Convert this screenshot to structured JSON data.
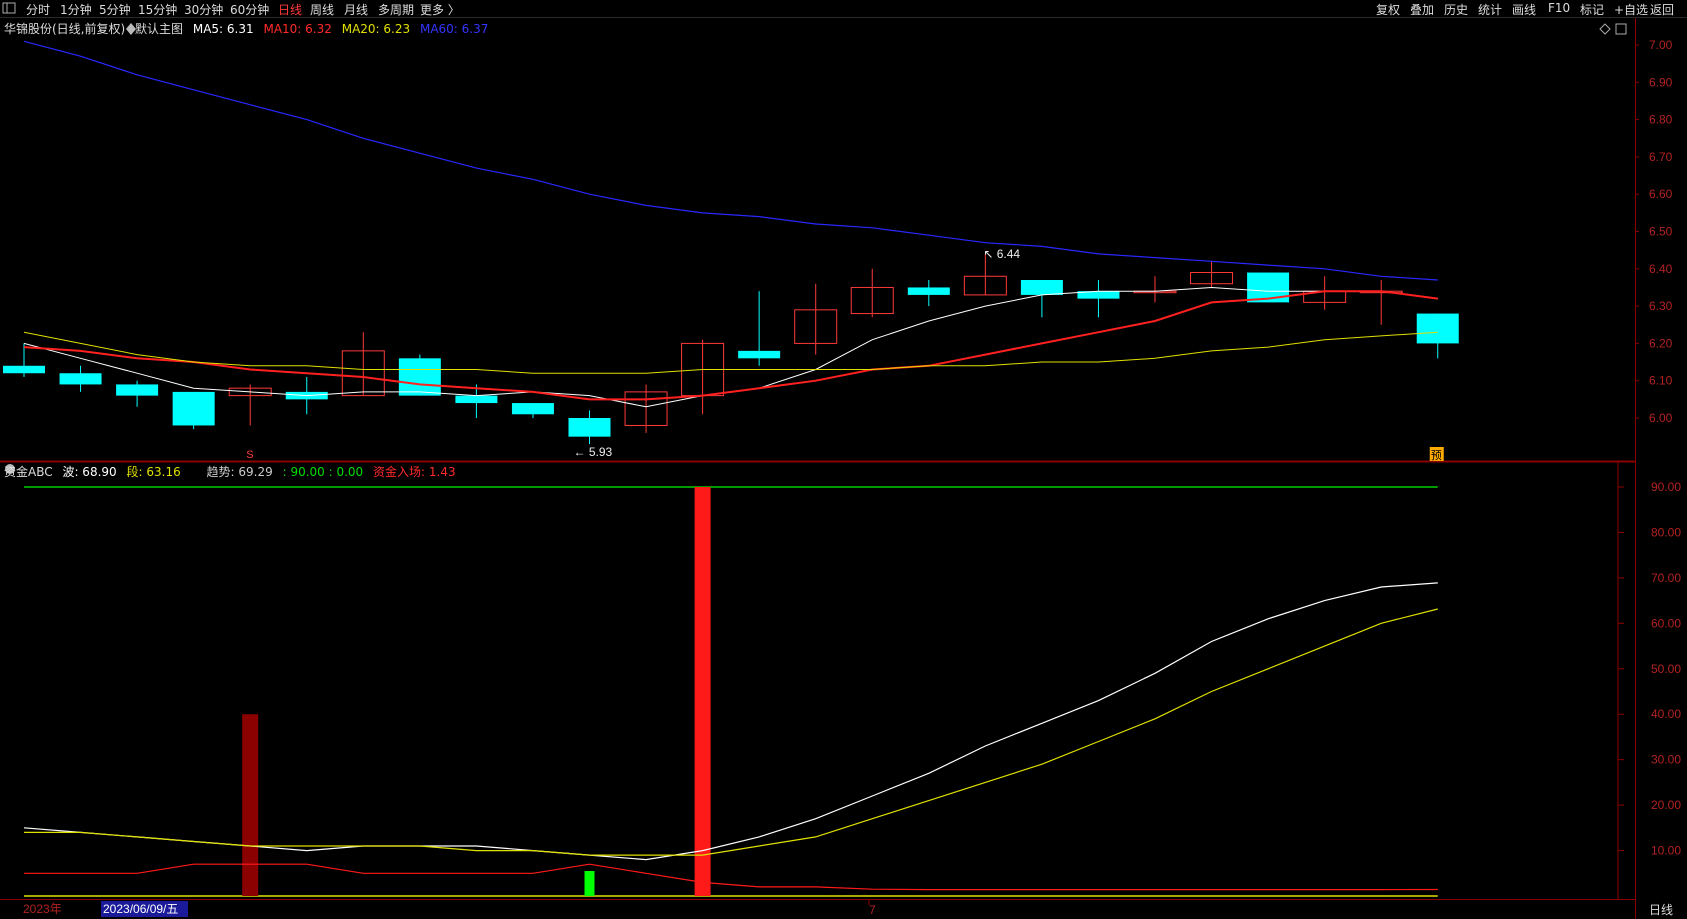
{
  "toolbar": {
    "left_items": [
      "分时",
      "1分钟",
      "5分钟",
      "15分钟",
      "30分钟",
      "60分钟",
      "日线",
      "周线",
      "月线",
      "多周期",
      "更多 〉"
    ],
    "active": "日线",
    "right_items": [
      "复权",
      "叠加",
      "历史",
      "统计",
      "画线",
      "F10",
      "标记",
      "+自选",
      "返回"
    ]
  },
  "main_legend": {
    "title": "华锦股份(日线,前复权)",
    "template": "默认主图",
    "ma5": "MA5: 6.31",
    "ma10": "MA10: 6.32",
    "ma20": "MA20: 6.23",
    "ma60": "MA60: 6.37"
  },
  "sub_legend": {
    "title": "资金ABC",
    "bo": "波: 68.90",
    "duan": "段: 63.16",
    "qushi": "趋势: 69.29",
    "line90": ": 90.00 : 0.00",
    "zijin": "资金入场: 1.43"
  },
  "bottom": {
    "year": "2023年",
    "date": "2023/06/09/五",
    "month": "7",
    "period": "日线"
  },
  "colors": {
    "up": "#ff3a3a",
    "down": "#00ffff",
    "ma5": "#ffffff",
    "ma10": "#ff2020",
    "ma20": "#e0e000",
    "ma60": "#2828ff",
    "grid": "#8b0000"
  },
  "chart_data": [
    {
      "type": "candlestick",
      "title": "华锦股份(日线,前复权)",
      "y_ticks": [
        "7.00",
        "6.90",
        "6.80",
        "6.70",
        "6.60",
        "6.50",
        "6.40",
        "6.30",
        "6.20",
        "6.10",
        "6.00"
      ],
      "ylim": [
        5.9,
        7.1
      ],
      "candles": [
        {
          "o": 6.14,
          "h": 6.2,
          "l": 6.11,
          "c": 6.12
        },
        {
          "o": 6.12,
          "h": 6.14,
          "l": 6.07,
          "c": 6.09
        },
        {
          "o": 6.09,
          "h": 6.1,
          "l": 6.03,
          "c": 6.06
        },
        {
          "o": 6.07,
          "h": 6.07,
          "l": 5.97,
          "c": 5.98
        },
        {
          "o": 6.06,
          "h": 6.09,
          "l": 5.98,
          "c": 6.08
        },
        {
          "o": 6.07,
          "h": 6.11,
          "l": 6.01,
          "c": 6.05
        },
        {
          "o": 6.06,
          "h": 6.23,
          "l": 6.06,
          "c": 6.18
        },
        {
          "o": 6.16,
          "h": 6.17,
          "l": 6.06,
          "c": 6.06
        },
        {
          "o": 6.06,
          "h": 6.09,
          "l": 6.0,
          "c": 6.04
        },
        {
          "o": 6.04,
          "h": 6.04,
          "l": 6.0,
          "c": 6.01
        },
        {
          "o": 6.0,
          "h": 6.02,
          "l": 5.93,
          "c": 5.95
        },
        {
          "o": 5.98,
          "h": 6.09,
          "l": 5.96,
          "c": 6.07
        },
        {
          "o": 6.06,
          "h": 6.21,
          "l": 6.01,
          "c": 6.2
        },
        {
          "o": 6.18,
          "h": 6.34,
          "l": 6.14,
          "c": 6.16
        },
        {
          "o": 6.2,
          "h": 6.36,
          "l": 6.17,
          "c": 6.29
        },
        {
          "o": 6.28,
          "h": 6.4,
          "l": 6.27,
          "c": 6.35
        },
        {
          "o": 6.35,
          "h": 6.37,
          "l": 6.3,
          "c": 6.33
        },
        {
          "o": 6.33,
          "h": 6.44,
          "l": 6.33,
          "c": 6.38
        },
        {
          "o": 6.37,
          "h": 6.37,
          "l": 6.27,
          "c": 6.33
        },
        {
          "o": 6.34,
          "h": 6.37,
          "l": 6.27,
          "c": 6.32
        },
        {
          "o": 6.34,
          "h": 6.38,
          "l": 6.31,
          "c": 6.34
        },
        {
          "o": 6.36,
          "h": 6.42,
          "l": 6.35,
          "c": 6.39
        },
        {
          "o": 6.39,
          "h": 6.39,
          "l": 6.31,
          "c": 6.31
        },
        {
          "o": 6.31,
          "h": 6.38,
          "l": 6.29,
          "c": 6.34
        },
        {
          "o": 6.34,
          "h": 6.37,
          "l": 6.25,
          "c": 6.34
        },
        {
          "o": 6.28,
          "h": 6.28,
          "l": 6.16,
          "c": 6.2
        }
      ],
      "series": [
        {
          "name": "MA5",
          "values": [
            6.2,
            6.16,
            6.12,
            6.08,
            6.07,
            6.06,
            6.07,
            6.07,
            6.06,
            6.07,
            6.06,
            6.03,
            6.06,
            6.08,
            6.13,
            6.21,
            6.26,
            6.3,
            6.33,
            6.34,
            6.34,
            6.35,
            6.34,
            6.34,
            6.34,
            6.32
          ]
        },
        {
          "name": "MA10",
          "values": [
            6.19,
            6.18,
            6.16,
            6.15,
            6.13,
            6.12,
            6.11,
            6.09,
            6.08,
            6.07,
            6.05,
            6.05,
            6.06,
            6.08,
            6.1,
            6.13,
            6.14,
            6.17,
            6.2,
            6.23,
            6.26,
            6.31,
            6.32,
            6.34,
            6.34,
            6.32
          ]
        },
        {
          "name": "MA20",
          "values": [
            6.23,
            6.2,
            6.17,
            6.15,
            6.14,
            6.14,
            6.13,
            6.13,
            6.13,
            6.12,
            6.12,
            6.12,
            6.13,
            6.13,
            6.13,
            6.13,
            6.14,
            6.14,
            6.15,
            6.15,
            6.16,
            6.18,
            6.19,
            6.21,
            6.22,
            6.23
          ]
        },
        {
          "name": "MA60",
          "values": [
            7.01,
            6.97,
            6.92,
            6.88,
            6.84,
            6.8,
            6.75,
            6.71,
            6.67,
            6.64,
            6.6,
            6.57,
            6.55,
            6.54,
            6.52,
            6.51,
            6.49,
            6.47,
            6.46,
            6.44,
            6.43,
            6.42,
            6.41,
            6.4,
            6.38,
            6.37
          ]
        }
      ],
      "annotations": [
        {
          "text": "6.44",
          "index": 17
        },
        {
          "text": "5.93",
          "index": 10
        },
        {
          "text": "预",
          "index": 25
        }
      ]
    },
    {
      "type": "line",
      "title": "资金ABC",
      "y_ticks": [
        "90.00",
        "80.00",
        "70.00",
        "60.00",
        "50.00",
        "40.00",
        "30.00",
        "20.00",
        "10.00"
      ],
      "ylim": [
        0,
        90
      ],
      "series": [
        {
          "name": "波",
          "values": [
            15,
            14,
            13,
            12,
            11,
            10,
            11,
            11,
            11,
            10,
            9,
            8,
            10,
            13,
            17,
            22,
            27,
            33,
            38,
            43,
            49,
            56,
            61,
            65,
            68,
            68.9
          ]
        },
        {
          "name": "段",
          "values": [
            14,
            14,
            13,
            12,
            11,
            11,
            11,
            11,
            10,
            10,
            9,
            9,
            9,
            11,
            13,
            17,
            21,
            25,
            29,
            34,
            39,
            45,
            50,
            55,
            60,
            63.16
          ]
        },
        {
          "name": "资金入场",
          "values": [
            5,
            5,
            5,
            7,
            7,
            7,
            5,
            5,
            5,
            5,
            7,
            5,
            3,
            2,
            2,
            1.5,
            1.4,
            1.4,
            1.4,
            1.4,
            1.4,
            1.4,
            1.4,
            1.4,
            1.4,
            1.43
          ]
        }
      ],
      "bars": [
        {
          "index": 4,
          "value": 40,
          "color": "#8b0000"
        },
        {
          "index": 10,
          "value": 5.5,
          "color": "#00ff00"
        },
        {
          "index": 12,
          "value": 90,
          "color": "#ff1a1a"
        }
      ],
      "reference_lines": [
        90,
        0
      ]
    }
  ]
}
